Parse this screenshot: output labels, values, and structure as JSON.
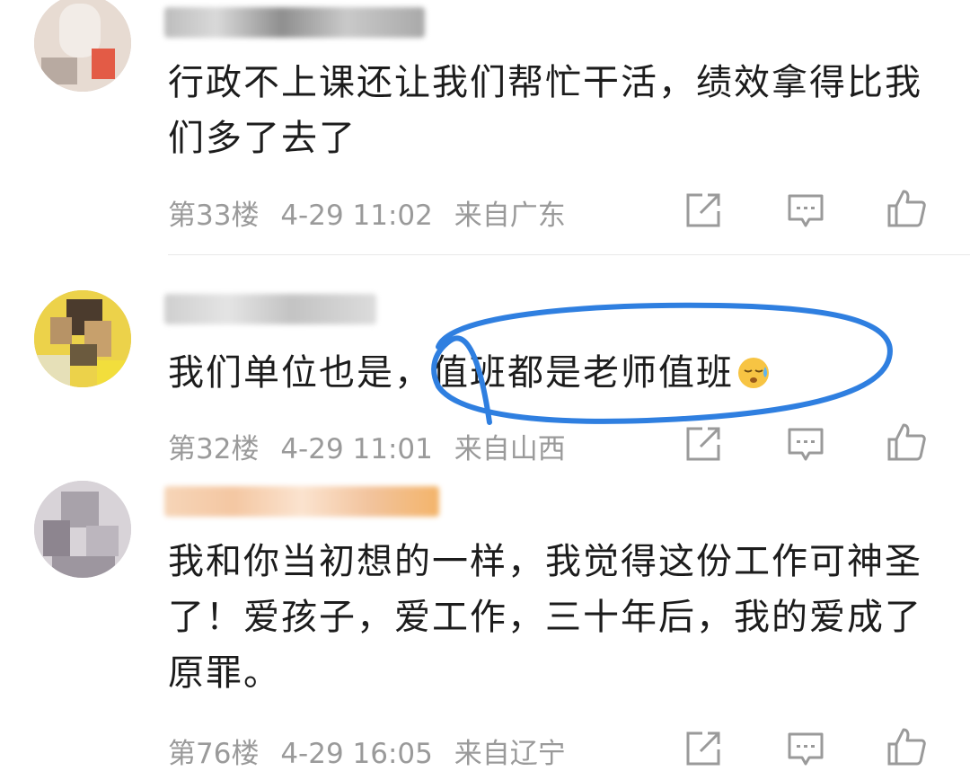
{
  "comments": [
    {
      "text": "行政不上课还让我们帮忙干活，绩效拿得比我们多了去了",
      "floor": "第33楼",
      "time": "4-29 11:02",
      "location": "来自广东"
    },
    {
      "text_before": "我们单位也是，",
      "text_highlight": "值班都是老师值班",
      "emoji": "sleepy-sweat-emoji",
      "floor": "第32楼",
      "time": "4-29 11:01",
      "location": "来自山西"
    },
    {
      "text": "我和你当初想的一样，我觉得这份工作可神圣了！爱孩子，爱工作，三十年后，我的爱成了原罪。",
      "floor": "第76楼",
      "time": "4-29 16:05",
      "location": "来自辽宁"
    }
  ],
  "icons": {
    "share": "share-icon",
    "reply": "reply-icon",
    "like": "thumbs-up-icon"
  },
  "colors": {
    "annotation": "#2f7fe0",
    "meta_text": "#9a9a9a",
    "icon": "#9a9a9a"
  }
}
